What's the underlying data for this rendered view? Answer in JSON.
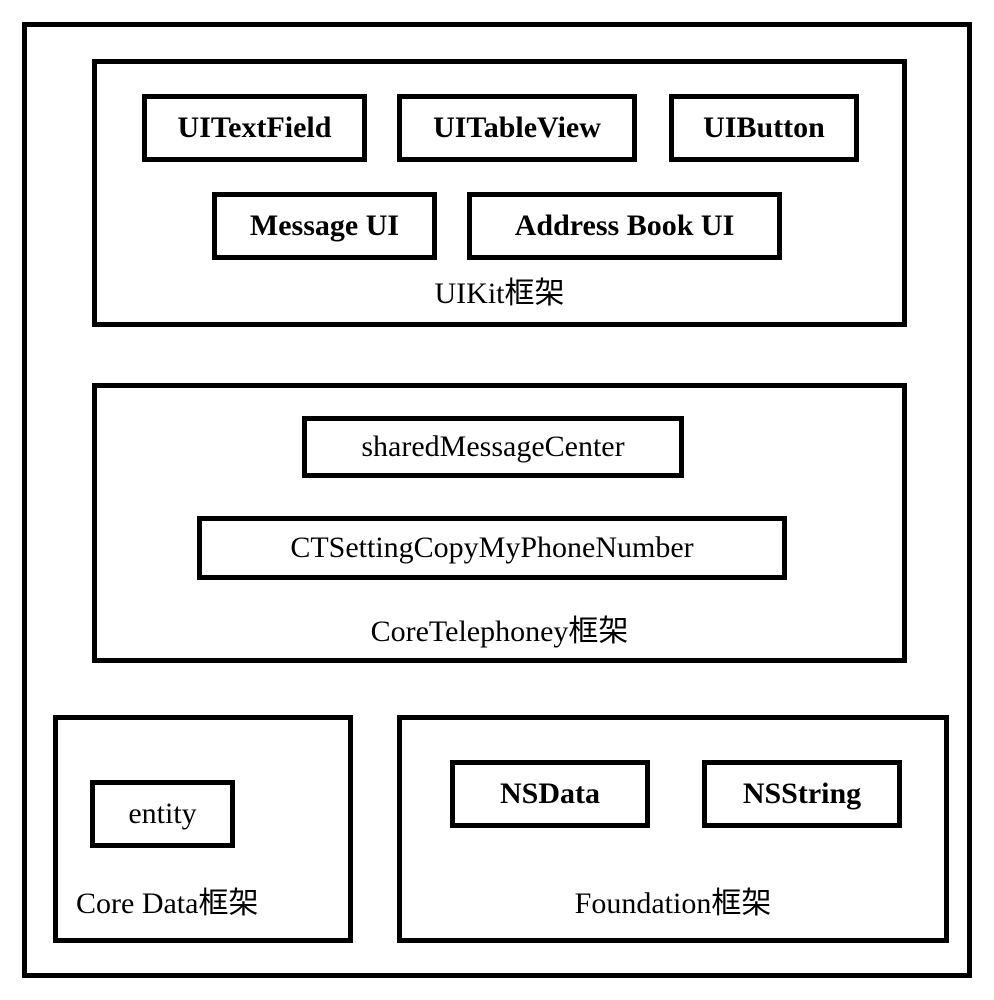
{
  "frameworks": {
    "uikit": {
      "title": "UIKit框架",
      "components": {
        "uitextfield": "UITextField",
        "uitableview": "UITableView",
        "uibutton": "UIButton",
        "messageui": "Message UI",
        "addressbookui": "Address Book UI"
      }
    },
    "coretelephony": {
      "title": "CoreTelephoney框架",
      "components": {
        "sharedmsg": "sharedMessageCenter",
        "ctsetting": "CTSettingCopyMyPhoneNumber"
      }
    },
    "coredata": {
      "title": "Core Data框架",
      "components": {
        "entity": "entity"
      }
    },
    "foundation": {
      "title": "Foundation框架",
      "components": {
        "nsdata": "NSData",
        "nsstring": "NSString"
      }
    }
  }
}
